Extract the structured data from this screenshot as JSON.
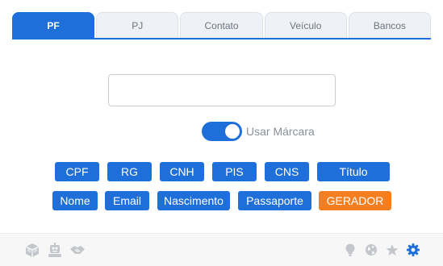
{
  "tabs": [
    "PF",
    "PJ",
    "Contato",
    "Veículo",
    "Bancos"
  ],
  "output": {
    "value": "",
    "placeholder": ""
  },
  "toggle": {
    "label": "Usar Márcara",
    "on": true
  },
  "buttons_row1": [
    "CPF",
    "RG",
    "CNH",
    "PIS",
    "CNS",
    "Título"
  ],
  "buttons_row2": [
    "Nome",
    "Email",
    "Nascimento",
    "Passaporte",
    "GERADOR"
  ],
  "footer": {
    "left_icons": [
      "package-icon",
      "robot-icon",
      "handshake-icon"
    ],
    "right_icons": [
      "lightbulb-icon",
      "globe-icon",
      "star-icon",
      "gear-icon"
    ]
  },
  "colors": {
    "accent": "#1e6fd9",
    "orange": "#f57f20",
    "icon_gray": "#b3b7bd"
  }
}
